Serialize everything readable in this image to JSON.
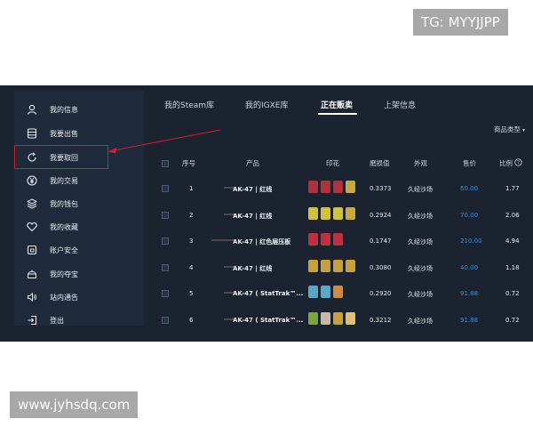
{
  "watermarks": {
    "tg": "TG: MYYJJPP",
    "site": "www.jyhsdq.com"
  },
  "sidebar": {
    "items": [
      {
        "label": "我的信息",
        "icon": "user-icon"
      },
      {
        "label": "我要出售",
        "icon": "database-icon"
      },
      {
        "label": "我要取回",
        "icon": "refresh-icon",
        "highlighted": true
      },
      {
        "label": "我的交易",
        "icon": "yen-circle-icon"
      },
      {
        "label": "我的钱包",
        "icon": "wallet-icon"
      },
      {
        "label": "我的收藏",
        "icon": "heart-icon"
      },
      {
        "label": "账户安全",
        "icon": "shield-icon"
      },
      {
        "label": "我的夺宝",
        "icon": "treasure-icon"
      },
      {
        "label": "站内通告",
        "icon": "speaker-icon"
      },
      {
        "label": "登出",
        "icon": "logout-icon"
      }
    ]
  },
  "tabs": [
    {
      "label": "我的Steam库"
    },
    {
      "label": "我的IGXE库"
    },
    {
      "label": "正在贩卖",
      "active": true
    },
    {
      "label": "上架信息"
    }
  ],
  "filter": {
    "label": "商品类型"
  },
  "table": {
    "headers": {
      "index": "序号",
      "product": "产品",
      "stickers": "印花",
      "wear": "磨损值",
      "exterior": "外观",
      "price": "售价",
      "ratio": "比例"
    },
    "rows": [
      {
        "index": "1",
        "product": "AK-47 | 红线",
        "wear": "0.3373",
        "exterior": "久经沙场",
        "price": "60.00",
        "ratio": "1.77",
        "sticker_colors": [
          "#b5303a",
          "#b5303a",
          "#b5303a",
          "#c9a842"
        ]
      },
      {
        "index": "2",
        "product": "AK-47 | 红线",
        "wear": "0.2924",
        "exterior": "久经沙场",
        "price": "70.00",
        "ratio": "2.06",
        "sticker_colors": [
          "#d4c236",
          "#d4c236",
          "#d4c236",
          "#c9a842"
        ]
      },
      {
        "index": "3",
        "product": "AK-47 | 红色层压板",
        "wear": "0.1747",
        "exterior": "久经沙场",
        "price": "210.00",
        "ratio": "4.94",
        "sticker_colors": [
          "#c2303e",
          "#c2303e",
          "#c2303e"
        ]
      },
      {
        "index": "4",
        "product": "AK-47 | 红线",
        "wear": "0.3080",
        "exterior": "久经沙场",
        "price": "40.00",
        "ratio": "1.18",
        "sticker_colors": [
          "#c7a23a",
          "#c7a23a",
          "#c7a23a",
          "#c7a23a"
        ]
      },
      {
        "index": "5",
        "product": "AK-47 ( StatTrak™...",
        "wear": "0.2920",
        "exterior": "久经沙场",
        "price": "91.88",
        "ratio": "0.72",
        "sticker_colors": [
          "#5aa8c8",
          "#5aa8c8",
          "#d08a3a"
        ]
      },
      {
        "index": "6",
        "product": "AK-47 ( StatTrak™...",
        "wear": "0.3212",
        "exterior": "久经沙场",
        "price": "91.88",
        "ratio": "0.72",
        "sticker_colors": [
          "#7aa83a",
          "#c9b8a8",
          "#c7a23a",
          "#e0c070"
        ]
      }
    ]
  },
  "colors": {
    "accent_price": "#2f8fe0",
    "highlight_border": "#d21f2a",
    "app_bg": "#1c2330",
    "sidebar_bg": "#1f2b3c"
  }
}
